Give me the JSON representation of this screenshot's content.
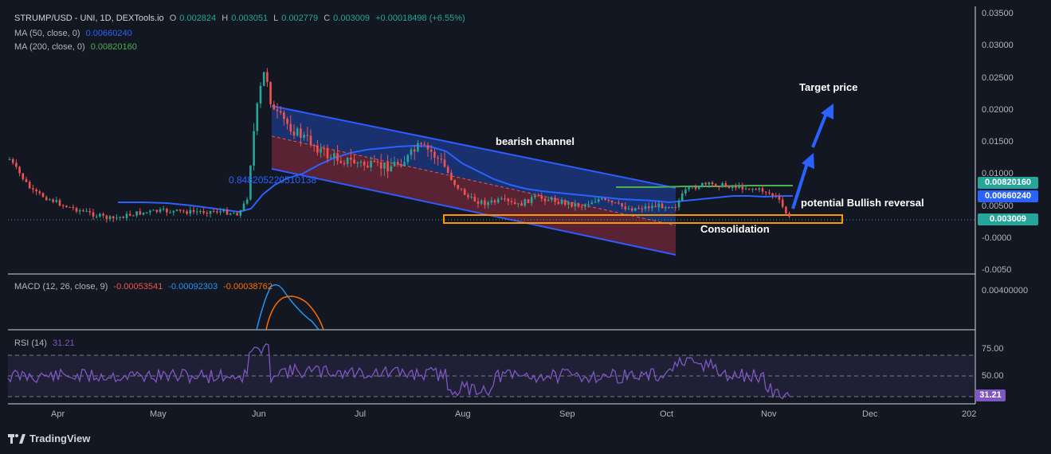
{
  "legend": {
    "symbol": "STRUMP/USD - UNI, 1D, DEXTools.io",
    "o_label": "O",
    "o_value": "0.002824",
    "h_label": "H",
    "h_value": "0.003051",
    "l_label": "L",
    "l_value": "0.002779",
    "c_label": "C",
    "c_value": "0.003009",
    "change": "+0.00018498 (+6.55%)",
    "ma50_label": "MA (50, close, 0)",
    "ma50_value": "0.00660240",
    "ma200_label": "MA (200, close, 0)",
    "ma200_value": "0.00820160",
    "macd_label": "MACD (12, 26, close, 9)",
    "macd_v1": "-0.00053541",
    "macd_v2": "-0.00092303",
    "macd_v3": "-0.00038762",
    "rsi_label": "RSI (14)",
    "rsi_value": "31.21"
  },
  "price_axis": [
    "0.03500",
    "0.03000",
    "0.02500",
    "0.02000",
    "0.01500",
    "0.01000",
    "0.00500",
    "-0.0000",
    "-0.0050"
  ],
  "price_tags": {
    "ma200": "0.00820160",
    "ma50": "0.00660240",
    "last": "0.003009"
  },
  "macd_axis": [
    "0.00400000"
  ],
  "rsi_axis": [
    "75.00",
    "50.00"
  ],
  "rsi_tag": "31.21",
  "time_axis": [
    "Apr",
    "May",
    "Jun",
    "Jul",
    "Aug",
    "Sep",
    "Oct",
    "Nov",
    "Dec",
    "202"
  ],
  "annotations": {
    "channel": "bearish channel",
    "target": "Target price",
    "reversal": "potential Bullish reversal",
    "consolidation": "Consolidation",
    "fib": "0.848205220510138"
  },
  "colors": {
    "background": "#131722",
    "up": "#26a69a",
    "down": "#ef5350",
    "ma50": "#2962ff",
    "ma200": "#4caf50",
    "channel_line": "#2f5bff",
    "consolidation": "#ff9800",
    "rsi": "#7e57c2",
    "macd": "#2196f3",
    "signal": "#ff6d00"
  },
  "footer": {
    "brand": "TradingView",
    "logo_icon": "tradingview-logo-icon"
  },
  "chart_data": {
    "type": "candlestick",
    "x_axis_months": [
      "Apr",
      "May",
      "Jun",
      "Jul",
      "Aug",
      "Sep",
      "Oct",
      "Nov",
      "Dec"
    ],
    "ylim": [
      -0.005,
      0.035
    ],
    "last_close": 0.003009,
    "series": [
      {
        "name": "MA (50, close, 0)",
        "last": 0.0066024
      },
      {
        "name": "MA (200, close, 0)",
        "last": 0.0082016
      },
      {
        "name": "RSI (14)",
        "last": 31.21
      }
    ],
    "rsi_levels": [
      75,
      50
    ]
  }
}
